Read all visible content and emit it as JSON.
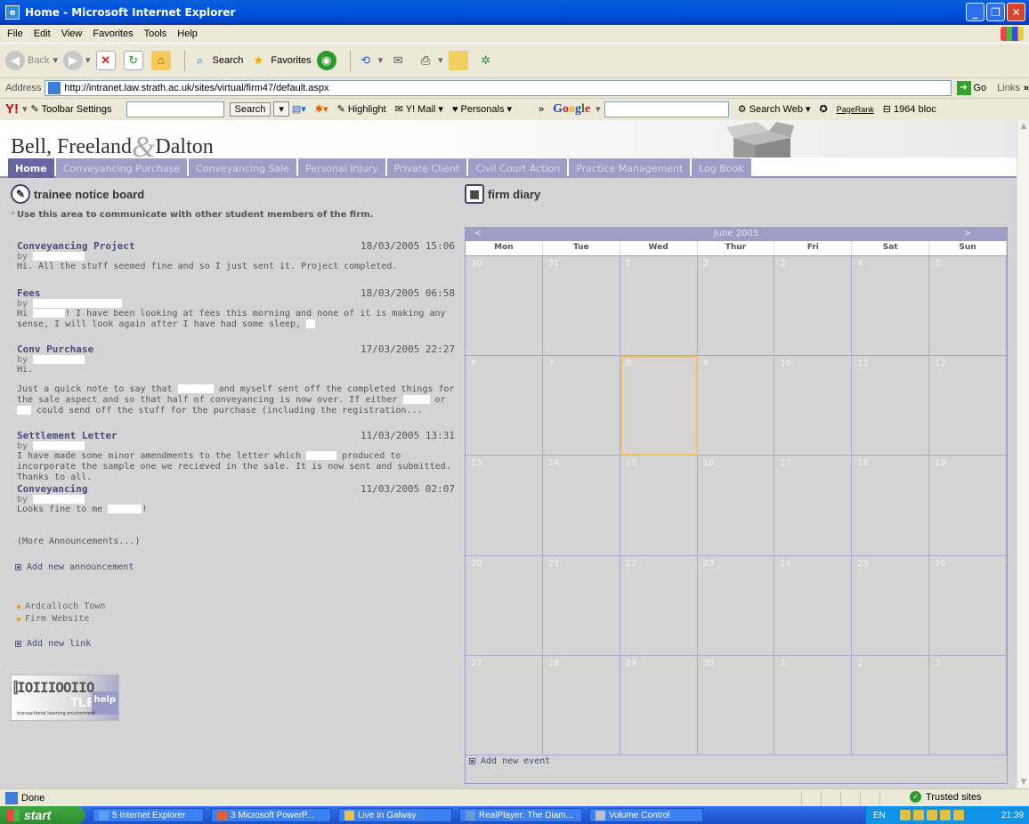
{
  "window": {
    "title": "Home - Microsoft Internet Explorer"
  },
  "menu": [
    "File",
    "Edit",
    "View",
    "Favorites",
    "Tools",
    "Help"
  ],
  "toolbar": {
    "back": "Back",
    "search": "Search",
    "favorites": "Favorites"
  },
  "address": {
    "label": "Address",
    "url": "http://intranet.law.strath.ac.uk/sites/virtual/firm47/default.aspx",
    "go": "Go",
    "links": "Links"
  },
  "yahoo": {
    "logo": "Y!",
    "settings": "Toolbar Settings",
    "search_btn": "Search",
    "highlight": "Highlight",
    "mail": "Y! Mail",
    "personals": "Personals",
    "google": [
      "G",
      "o",
      "o",
      "g",
      "l",
      "e"
    ],
    "search_web": "Search Web",
    "pagerank": "PageRank",
    "blocked": "1964 bloc"
  },
  "site": {
    "title_part1": "Bell, Freeland",
    "title_amp": "&",
    "title_part2": "Dalton",
    "tabs": [
      "Home",
      "Conveyancing Purchase",
      "Conveyancing Sale",
      "Personal Injury",
      "Private Client",
      "Civil Court Action",
      "Practice Management",
      "Log Book"
    ]
  },
  "board": {
    "heading": "trainee notice board",
    "hint": "Use this area to communicate with other student members of the firm.",
    "announcements": [
      {
        "title": "Conveyancing Project",
        "date": "18/03/2005 15:06",
        "by": "by",
        "body": "Hi. All the stuff seemed fine and so I just sent it. Project completed."
      },
      {
        "title": "Fees",
        "date": "18/03/2005 06:58",
        "by": "by",
        "body_a": "Hi",
        "body_b": "! I have been looking at fees this morning and none of it is making any sense, I will look again after I have had some sleep,"
      },
      {
        "title": "Conv Purchase",
        "date": "17/03/2005 22:27",
        "by": "by",
        "greeting": "Hi.",
        "body_a": "Just a quick note to say that",
        "body_b": "and myself sent off the completed things for the sale aspect and so that half of conveyancing is now over. If either",
        "body_c": "or",
        "body_d": "could send off the stuff for the purchase (including the registration..."
      },
      {
        "title": "Settlement Letter",
        "date": "11/03/2005 13:31",
        "by": "by",
        "body_a": "I have made some minor amendments to the letter which",
        "body_b": "produced to incorporate the sample one we recieved in the sale. It is now sent and submitted. Thanks to all."
      },
      {
        "title": "Conveyancing",
        "date": "11/03/2005 02:07",
        "by": "by",
        "body_a": "Looks fine to me",
        "body_b": "!"
      }
    ],
    "more": "(More Announcements...)",
    "add_announcement": "Add new announcement",
    "links": [
      "Ardcalloch Town",
      "Firm Website"
    ],
    "add_link": "Add new link",
    "logo_text": "TLE",
    "logo_help": "help",
    "logo_tag": "transactional learning environment"
  },
  "diary": {
    "heading": "firm diary",
    "prev": "<",
    "next": ">",
    "month": "June 2005",
    "days": [
      "Mon",
      "Tue",
      "Wed",
      "Thur",
      "Fri",
      "Sat",
      "Sun"
    ],
    "dates": [
      "30",
      "31",
      "1",
      "2",
      "3",
      "4",
      "5",
      "6",
      "7",
      "8",
      "9",
      "10",
      "11",
      "12",
      "13",
      "14",
      "15",
      "16",
      "17",
      "18",
      "19",
      "20",
      "21",
      "22",
      "23",
      "24",
      "25",
      "26",
      "27",
      "28",
      "29",
      "30",
      "1",
      "2",
      "3"
    ],
    "today_index": 9,
    "add_event": "Add new event"
  },
  "status": {
    "text": "Done",
    "zone": "Trusted sites"
  },
  "taskbar": {
    "start": "start",
    "tasks": [
      "5 Internet Explorer",
      "3 Microsoft PowerP...",
      "Live In Galway",
      "RealPlayer: The Diam...",
      "Volume Control"
    ],
    "lang": "EN",
    "clock": "21:39"
  }
}
